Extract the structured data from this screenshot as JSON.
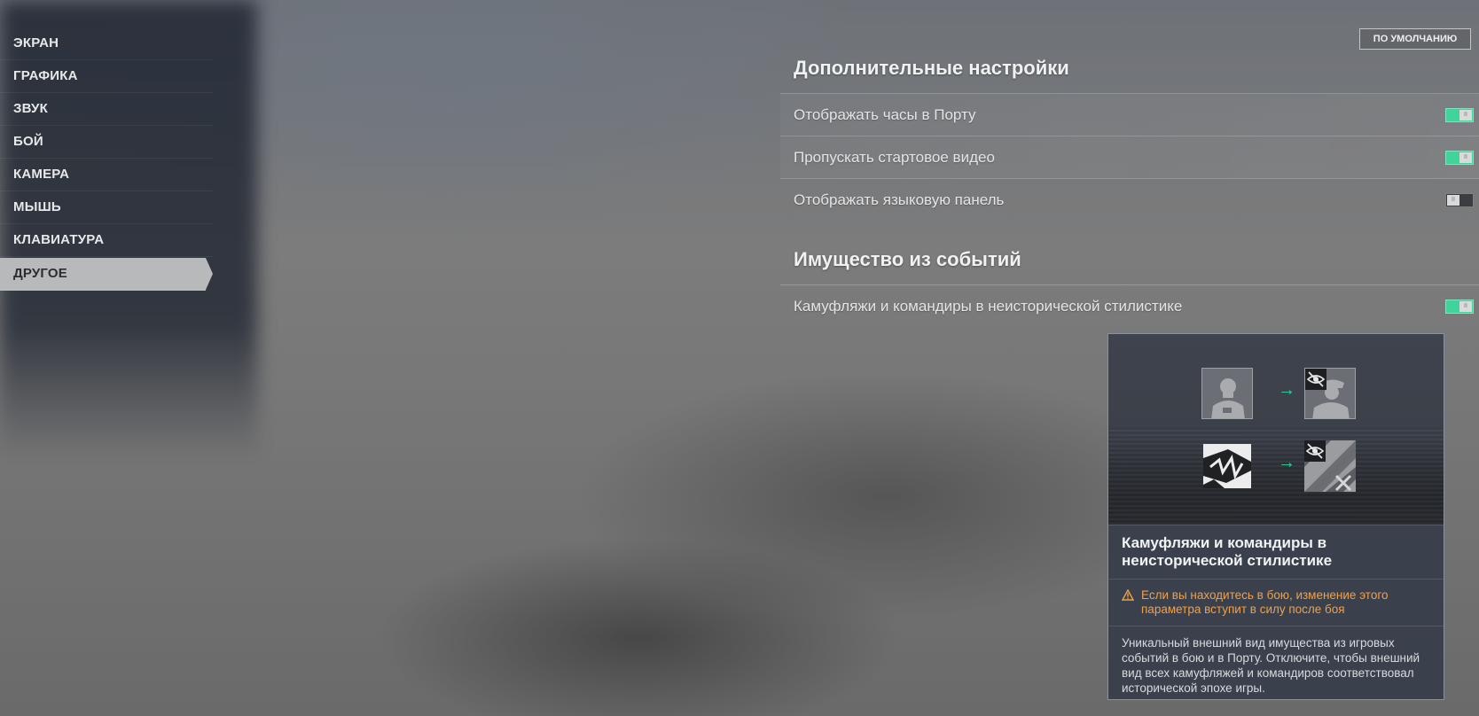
{
  "sidebar": {
    "items": [
      {
        "label": "ЭКРАН"
      },
      {
        "label": "ГРАФИКА"
      },
      {
        "label": "ЗВУК"
      },
      {
        "label": "БОЙ"
      },
      {
        "label": "КАМЕРА"
      },
      {
        "label": "МЫШЬ"
      },
      {
        "label": "КЛАВИАТУРА"
      },
      {
        "label": "ДРУГОЕ",
        "active": true
      }
    ]
  },
  "header": {
    "default_button_label": "ПО УМОЛЧАНИЮ"
  },
  "sections": [
    {
      "title": "Дополнительные настройки",
      "settings": [
        {
          "label": "Отображать часы в Порту",
          "enabled": true
        },
        {
          "label": "Пропускать стартовое видео",
          "enabled": true
        },
        {
          "label": "Отображать языковую панель",
          "enabled": false
        }
      ]
    },
    {
      "title": "Имущество из событий",
      "settings": [
        {
          "label": "Камуфляжи и командиры в неисторической стилистике",
          "enabled": true
        }
      ]
    }
  ],
  "tooltip": {
    "title": "Камуфляжи и командиры в неисторической стилистике",
    "warning": "Если вы находитесь в бою, изменение этого параметра вступит в силу после боя",
    "description": "Уникальный внешний вид имущества из игровых событий в бою и в Порту. Отключите, чтобы внешний вид всех камуфляжей и командиров соответствовал исторической эпохе игры.",
    "arrow_glyph": "→",
    "icons": [
      "commander-silhouette-icon",
      "hidden-eye-icon",
      "camouflage-pattern-icon"
    ]
  },
  "colors": {
    "toggle_on": "#3ed49a",
    "warning": "#f0a04a",
    "active_tab": "#b8b9bb",
    "tooltip_bg": "#3b404d"
  }
}
